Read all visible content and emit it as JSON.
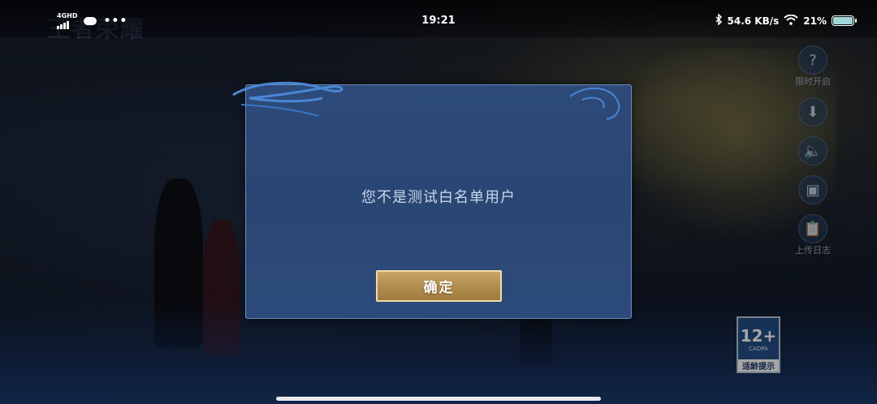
{
  "status_bar": {
    "network": "4GHD",
    "more": "•••",
    "time": "19:21",
    "speed": "54.6 KB/s",
    "battery": "21%"
  },
  "background": {
    "logo_text": "王者荣耀",
    "side_menu": [
      {
        "icon": "question-icon",
        "glyph": "?",
        "label": "限时开启"
      },
      {
        "icon": "download-icon",
        "glyph": "⬇",
        "label": ""
      },
      {
        "icon": "speaker-icon",
        "glyph": "🔈",
        "label": ""
      },
      {
        "icon": "card-icon",
        "glyph": "▣",
        "label": ""
      },
      {
        "icon": "clipboard-icon",
        "glyph": "📋",
        "label": "上传日志"
      }
    ],
    "age_rating": {
      "number": "12+",
      "org": "CADPA",
      "tip": "适龄提示"
    }
  },
  "dialog": {
    "message": "您不是测试白名单用户",
    "confirm_label": "确定"
  },
  "colors": {
    "dialog_bg": "#2d4a78",
    "button_gold": "#b28d4f"
  }
}
